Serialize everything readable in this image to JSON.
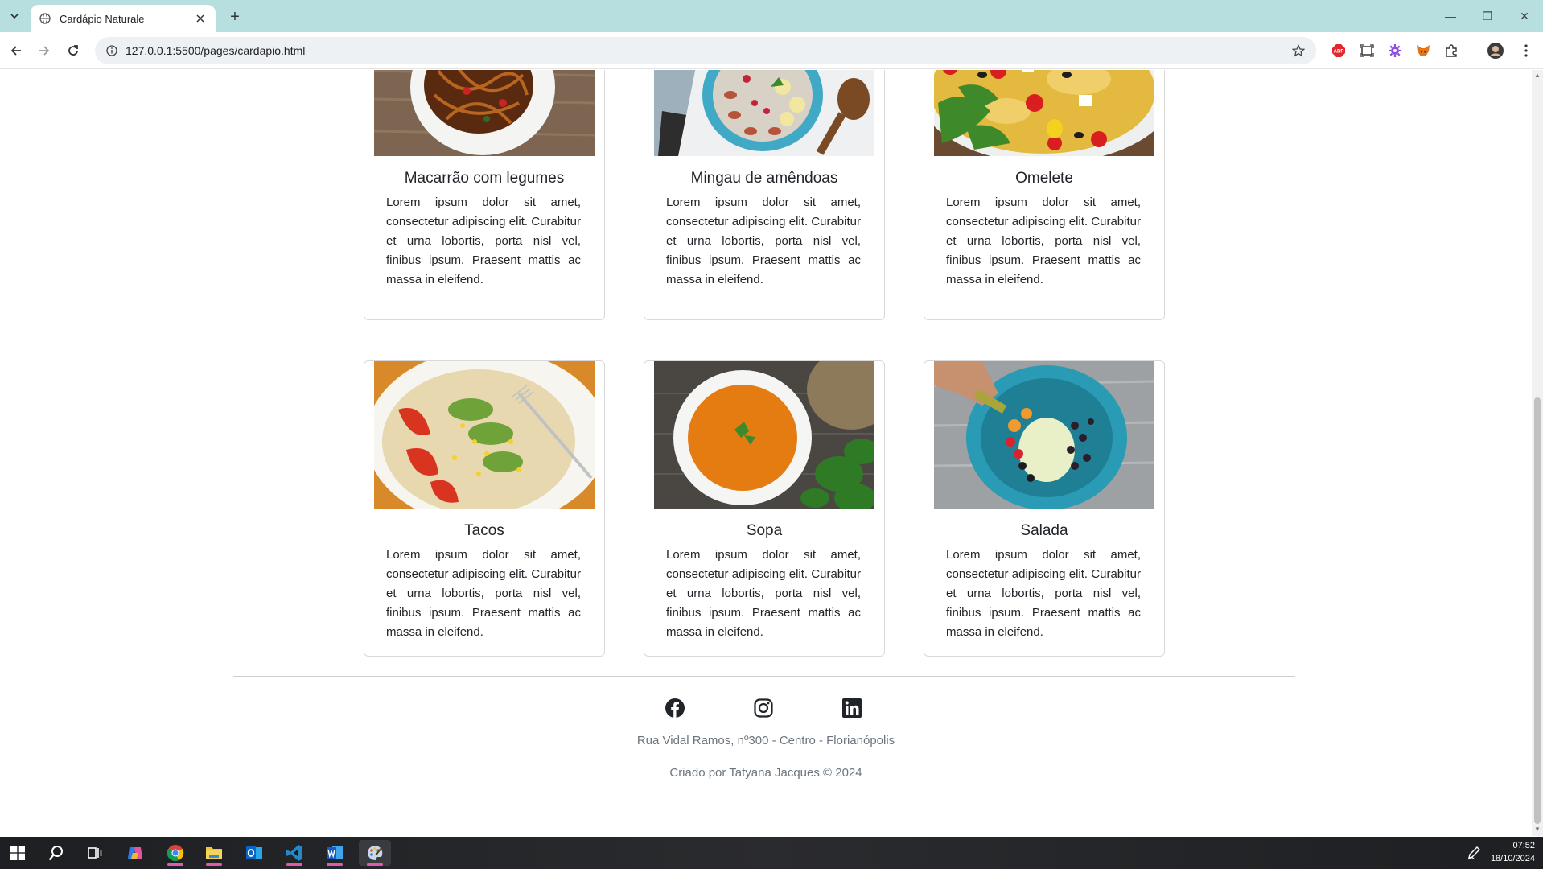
{
  "browser": {
    "tab_title": "Cardápio Naturale",
    "url": "127.0.0.1:5500/pages/cardapio.html",
    "new_tab_label": "+",
    "minimize_label": "—",
    "restore_label": "❐",
    "close_label": "✕"
  },
  "menu": {
    "items": [
      {
        "name": "Macarrão com legumes",
        "description": "Lorem ipsum dolor sit amet, consectetur adipiscing elit. Curabitur et urna lobortis, porta nisl vel, finibus ipsum. Praesent mattis ac massa in eleifend."
      },
      {
        "name": "Mingau de amêndoas",
        "description": "Lorem ipsum dolor sit amet, consectetur adipiscing elit. Curabitur et urna lobortis, porta nisl vel, finibus ipsum. Praesent mattis ac massa in eleifend."
      },
      {
        "name": "Omelete",
        "description": "Lorem ipsum dolor sit amet, consectetur adipiscing elit. Curabitur et urna lobortis, porta nisl vel, finibus ipsum. Praesent mattis ac massa in eleifend."
      },
      {
        "name": "Tacos",
        "description": "Lorem ipsum dolor sit amet, consectetur adipiscing elit. Curabitur et urna lobortis, porta nisl vel, finibus ipsum. Praesent mattis ac massa in eleifend."
      },
      {
        "name": "Sopa",
        "description": "Lorem ipsum dolor sit amet, consectetur adipiscing elit. Curabitur et urna lobortis, porta nisl vel, finibus ipsum. Praesent mattis ac massa in eleifend."
      },
      {
        "name": "Salada",
        "description": "Lorem ipsum dolor sit amet, consectetur adipiscing elit. Curabitur et urna lobortis, porta nisl vel, finibus ipsum. Praesent mattis ac massa in eleifend."
      }
    ]
  },
  "footer": {
    "social": [
      "facebook-icon",
      "instagram-icon",
      "linkedin-icon"
    ],
    "address": "Rua Vidal Ramos, nº300 - Centro - Florianópolis",
    "credit": "Criado por Tatyana Jacques © 2024"
  },
  "taskbar": {
    "time": "07:52",
    "date": "18/10/2024"
  },
  "colors": {
    "tabstrip": "#b8dfe0",
    "taskbar_accent": "#e05bb0",
    "text_muted": "#6c757d"
  }
}
